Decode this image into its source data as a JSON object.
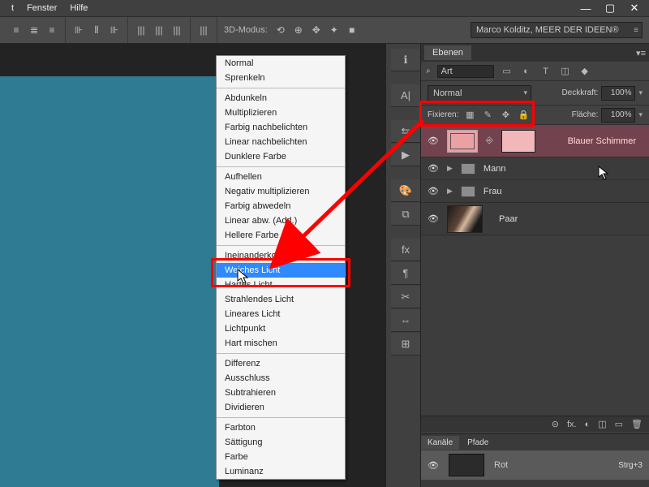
{
  "menu": {
    "m1": "t",
    "m2": "Fenster",
    "m3": "Hilfe"
  },
  "win": {
    "min": "—",
    "max": "▢",
    "close": "✕"
  },
  "options": {
    "mode": "3D-Modus:",
    "preset": "Marco Kolditz, MEER DER IDEEN®"
  },
  "dock": [
    "ℹ",
    "A|",
    "⇆",
    "▶",
    "🎨",
    "⧉",
    "fx",
    "¶",
    "✂",
    "⇔",
    "⊞"
  ],
  "panel": {
    "tab": "Ebenen",
    "filter_label": "Art",
    "filter_icons": [
      "▭",
      "◐",
      "T",
      "◫",
      "◆"
    ],
    "blend": "Normal",
    "opacity_lbl": "Deckkraft:",
    "opacity_val": "100%",
    "lock_lbl": "Fixieren:",
    "lock_icons": [
      "▦",
      "✎",
      "✥",
      "🔒"
    ],
    "fill_lbl": "Fläche:",
    "fill_val": "100%"
  },
  "layers": {
    "l0_name": "Blauer Schimmer",
    "g1": "Mann",
    "g2": "Frau",
    "l3": "Paar"
  },
  "foot": [
    "⊝",
    "fx.",
    "◐",
    "◫",
    "▭",
    "🗑"
  ],
  "channels": {
    "t1": "Kanäle",
    "t2": "Pfade",
    "c1": "Rot",
    "c1k": "Strg+3"
  },
  "bm": {
    "g0": [
      "Normal",
      "Sprenkeln"
    ],
    "g1": [
      "Abdunkeln",
      "Multiplizieren",
      "Farbig nachbelichten",
      "Linear nachbelichten",
      "Dunklere Farbe"
    ],
    "g2": [
      "Aufhellen",
      "Negativ multiplizieren",
      "Farbig abwedeln",
      "Linear abw. (Add.)",
      "Hellere Farbe"
    ],
    "g3": [
      "Ineinanderkopieren",
      "Weiches Licht",
      "Hartes Licht",
      "Strahlendes Licht",
      "Lineares Licht",
      "Lichtpunkt",
      "Hart mischen"
    ],
    "g4": [
      "Differenz",
      "Ausschluss",
      "Subtrahieren",
      "Dividieren"
    ],
    "g5": [
      "Farbton",
      "Sättigung",
      "Farbe",
      "Luminanz"
    ]
  }
}
